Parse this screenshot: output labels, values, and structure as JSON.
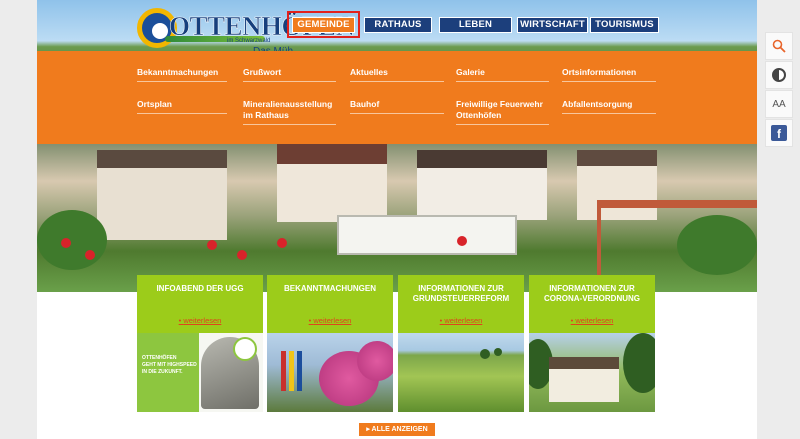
{
  "header": {
    "logo_name": "OTTENHÖFEN",
    "logo_sub": "im Schwarzwald",
    "logo_tag": "Das Müh"
  },
  "nav": [
    {
      "label": "GEMEINDE",
      "active": true
    },
    {
      "label": "RATHAUS",
      "active": false
    },
    {
      "label": "LEBEN",
      "active": false
    },
    {
      "label": "WIRTSCHAFT",
      "active": false
    },
    {
      "label": "TOURISMUS",
      "active": false
    }
  ],
  "dropdown": [
    [
      "Bekanntmachungen",
      "Grußwort",
      "Aktuelles",
      "Galerie",
      "Ortsinformationen"
    ],
    [
      "Ortsplan",
      "Mineralienausstellung im Rathaus",
      "Bauhof",
      "Freiwillige Feuerwehr Ottenhöfen",
      "Abfallentsorgung"
    ]
  ],
  "cards": [
    {
      "title": "INFOABEND DER UGG",
      "more": "weiterlesen"
    },
    {
      "title": "BEKANNTMACHUNGEN",
      "more": "weiterlesen"
    },
    {
      "title": "INFORMATIONEN ZUR GRUNDSTEUERREFORM",
      "more": "weiterlesen"
    },
    {
      "title": "INFORMATIONEN ZUR CORONA-VERORDNUNG",
      "more": "weiterlesen"
    }
  ],
  "ugg_flyer": {
    "line1": "OTTENHÖFEN",
    "line2": "GEHT MIT HIGHSPEED",
    "line3": "IN DIE ZUKUNFT."
  },
  "show_all": "ALLE ANZEIGEN",
  "side_toolbar": {
    "search_icon": "search-icon",
    "contrast_icon": "contrast-icon",
    "font_size_label": "AA",
    "facebook_label": "f"
  },
  "colors": {
    "accent_orange": "#f07b1d",
    "nav_blue": "#1c3f7c",
    "card_green": "#9ccc1a",
    "active_marker": "#e2211c"
  }
}
